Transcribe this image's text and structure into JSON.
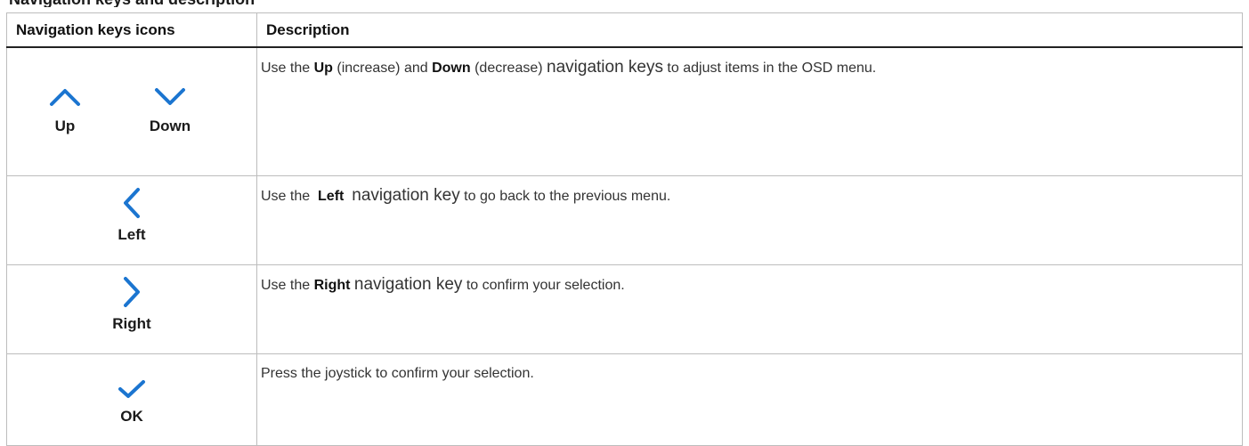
{
  "clipped_heading": "Navigation keys and description",
  "table": {
    "headers": [
      "Navigation keys icons",
      "Description"
    ],
    "accent_color": "#1b75d0",
    "rows": [
      {
        "icons": [
          {
            "name": "chevron-up-icon",
            "label": "Up"
          },
          {
            "name": "chevron-down-icon",
            "label": "Down"
          }
        ],
        "description": {
          "p1": "Use the ",
          "b1": "Up",
          "p2": " (increase) and ",
          "b2": "Down",
          "p3": " (decrease) ",
          "big": "navigation keys",
          "p4": " to adjust items in the OSD menu."
        }
      },
      {
        "icons": [
          {
            "name": "chevron-left-icon",
            "label": "Left"
          }
        ],
        "description": {
          "p1": "Use the  ",
          "b1": "Left",
          "p2": "  ",
          "big": "navigation key",
          "p3": " to go back to the previous menu."
        }
      },
      {
        "icons": [
          {
            "name": "chevron-right-icon",
            "label": "Right"
          }
        ],
        "description": {
          "p1": "Use the ",
          "b1": "Right",
          "p2": " ",
          "big": "navigation key",
          "p3": " to confirm your selection."
        }
      },
      {
        "icons": [
          {
            "name": "check-icon",
            "label": "OK"
          }
        ],
        "description": {
          "p1": "Press the joystick to confirm your selection."
        }
      }
    ]
  }
}
